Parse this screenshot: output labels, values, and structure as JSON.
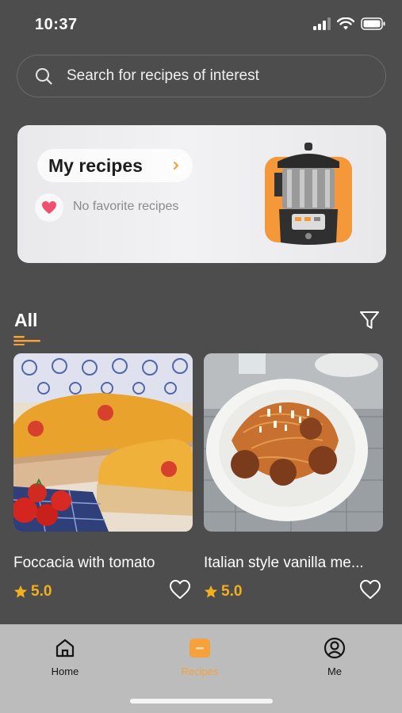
{
  "status_bar": {
    "time": "10:37",
    "icons": [
      "signal-icon",
      "wifi-icon",
      "battery-icon"
    ]
  },
  "search": {
    "placeholder": "Search for recipes of interest",
    "icon": "search-icon"
  },
  "my_recipes": {
    "title": "My recipes",
    "empty_text": "No favorite recipes",
    "icons": [
      "chevron-right-icon",
      "heart-icon",
      "kitchen-appliance-image"
    ]
  },
  "section": {
    "title": "All",
    "icons": [
      "fork-icon",
      "filter-icon"
    ]
  },
  "recipes": [
    {
      "name": "Foccacia with tomato",
      "rating": "5.0",
      "image": "focaccia-image"
    },
    {
      "name": "Italian style vanilla me...",
      "rating": "5.0",
      "image": "spaghetti-meatballs-image"
    }
  ],
  "bottom_nav": [
    {
      "label": "Home",
      "icon": "home-icon",
      "active": false
    },
    {
      "label": "Recipes",
      "icon": "recipes-icon",
      "active": true
    },
    {
      "label": "Me",
      "icon": "profile-icon",
      "active": false
    }
  ],
  "colors": {
    "background": "#4d4d4d",
    "accent": "#f5a23c",
    "rating": "#f2b01e",
    "nav_background": "#bcbcbc"
  }
}
